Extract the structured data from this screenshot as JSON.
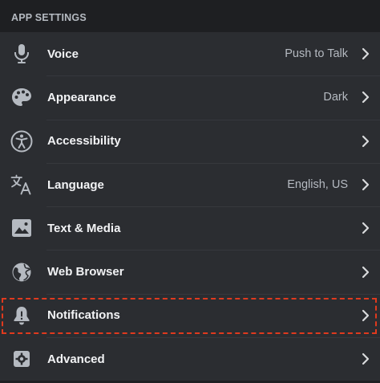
{
  "section": {
    "title": "APP SETTINGS"
  },
  "items": [
    {
      "label": "Voice",
      "value": "Push to Talk",
      "icon": "microphone-icon"
    },
    {
      "label": "Appearance",
      "value": "Dark",
      "icon": "palette-icon"
    },
    {
      "label": "Accessibility",
      "value": "",
      "icon": "accessibility-icon"
    },
    {
      "label": "Language",
      "value": "English, US",
      "icon": "translate-icon"
    },
    {
      "label": "Text & Media",
      "value": "",
      "icon": "image-icon"
    },
    {
      "label": "Web Browser",
      "value": "",
      "icon": "globe-icon"
    },
    {
      "label": "Notifications",
      "value": "",
      "icon": "bell-icon"
    },
    {
      "label": "Advanced",
      "value": "",
      "icon": "gear-icon"
    }
  ],
  "colors": {
    "background": "#1e1f22",
    "row_background": "#2b2d31",
    "text_primary": "#f2f3f5",
    "text_secondary": "#b5bac1",
    "icon": "#b5bac1",
    "highlight": "#e03a1e"
  }
}
